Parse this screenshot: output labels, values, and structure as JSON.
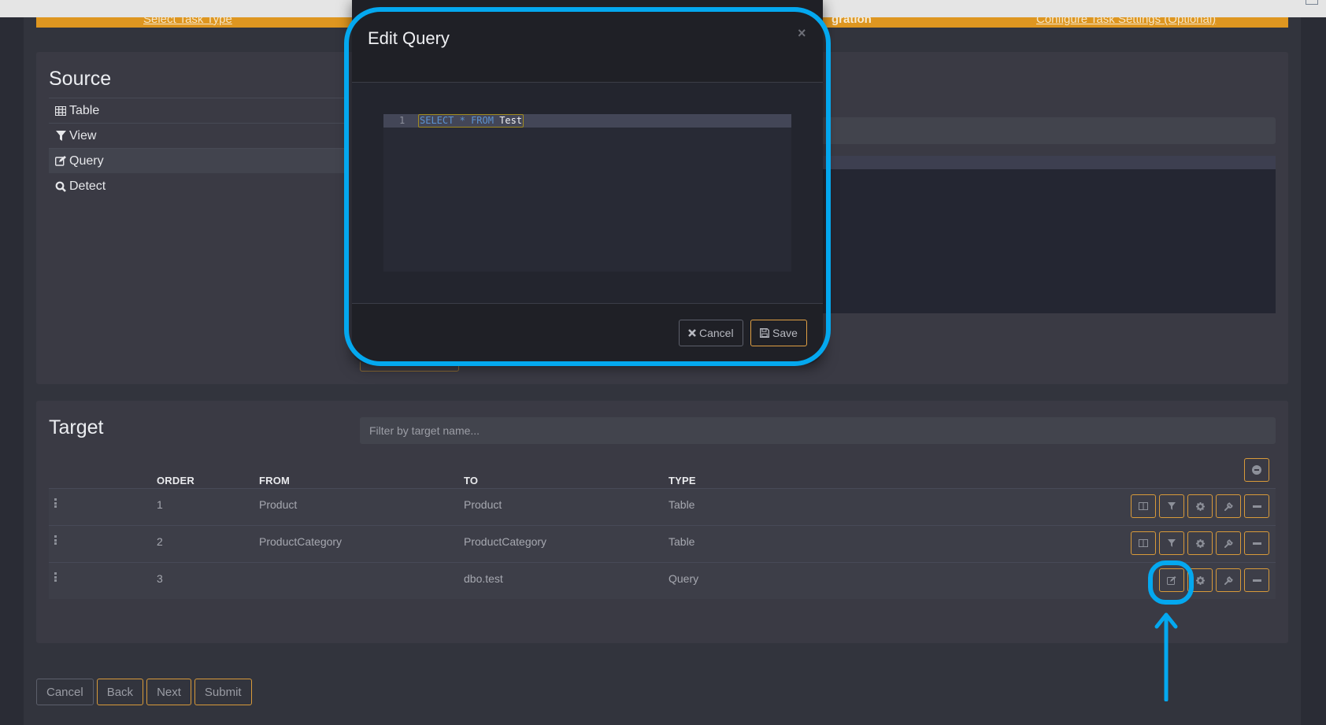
{
  "wizard": {
    "steps": [
      {
        "label": "Select Task Type",
        "state": "link"
      },
      {
        "label": "gration",
        "state": "current"
      },
      {
        "label": "Configure Task Settings (Optional)",
        "state": "link"
      }
    ]
  },
  "source": {
    "title": "Source",
    "items": [
      {
        "icon": "table-icon",
        "label": "Table",
        "active": false
      },
      {
        "icon": "filter-icon",
        "label": "View",
        "active": false
      },
      {
        "icon": "edit-icon",
        "label": "Query",
        "active": true
      },
      {
        "icon": "search-icon",
        "label": "Detect",
        "active": false
      }
    ]
  },
  "target": {
    "title": "Target",
    "filter_placeholder": "Filter by target name...",
    "filter_value": "",
    "columns": [
      "ORDER",
      "FROM",
      "TO",
      "TYPE"
    ],
    "rows": [
      {
        "order": "1",
        "from": "Product",
        "to": "Product",
        "type": "Table",
        "actions": [
          "columns",
          "filter",
          "settings",
          "wrench",
          "remove"
        ]
      },
      {
        "order": "2",
        "from": "ProductCategory",
        "to": "ProductCategory",
        "type": "Table",
        "actions": [
          "columns",
          "filter",
          "settings",
          "wrench",
          "remove"
        ]
      },
      {
        "order": "3",
        "from": "",
        "to": "dbo.test",
        "type": "Query",
        "actions": [
          "edit",
          "settings",
          "wrench",
          "remove"
        ]
      }
    ]
  },
  "footer": {
    "cancel": "Cancel",
    "back": "Back",
    "next": "Next",
    "submit": "Submit"
  },
  "modal": {
    "title": "Edit Query",
    "close": "×",
    "editor": {
      "line_number": "1",
      "tokens": [
        {
          "text": "SELECT",
          "kind": "keyword"
        },
        {
          "text": " ",
          "kind": "space"
        },
        {
          "text": "*",
          "kind": "keyword"
        },
        {
          "text": " ",
          "kind": "space"
        },
        {
          "text": "FROM",
          "kind": "keyword"
        },
        {
          "text": " ",
          "kind": "space"
        },
        {
          "text": "Test",
          "kind": "identifier"
        }
      ]
    },
    "cancel_label": "Cancel",
    "save_label": "Save"
  },
  "colors": {
    "accent": "#de9620",
    "button_border": "#d89a3a",
    "highlight": "#04a8ef",
    "sql_keyword": "#5c93d1"
  }
}
